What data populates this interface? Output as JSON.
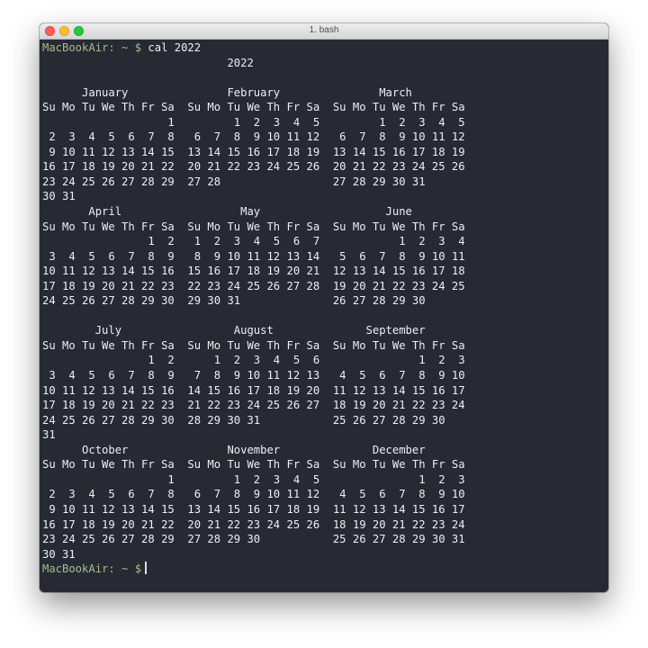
{
  "window": {
    "title": "1. bash",
    "traffic_light_colors": {
      "close": "#ff5f57",
      "minimize": "#ffbd2e",
      "zoom": "#28c940"
    }
  },
  "terminal": {
    "background": "#272a33",
    "prompt_color": "#a3be8c",
    "prompt": "MacBookAir: ~ $",
    "command": " cal 2022",
    "output_lines": [
      "                            2022",
      "",
      "      January               February               March",
      "Su Mo Tu We Th Fr Sa  Su Mo Tu We Th Fr Sa  Su Mo Tu We Th Fr Sa",
      "                   1         1  2  3  4  5         1  2  3  4  5",
      " 2  3  4  5  6  7  8   6  7  8  9 10 11 12   6  7  8  9 10 11 12",
      " 9 10 11 12 13 14 15  13 14 15 16 17 18 19  13 14 15 16 17 18 19",
      "16 17 18 19 20 21 22  20 21 22 23 24 25 26  20 21 22 23 24 25 26",
      "23 24 25 26 27 28 29  27 28                 27 28 29 30 31",
      "30 31",
      "       April                  May                   June",
      "Su Mo Tu We Th Fr Sa  Su Mo Tu We Th Fr Sa  Su Mo Tu We Th Fr Sa",
      "                1  2   1  2  3  4  5  6  7            1  2  3  4",
      " 3  4  5  6  7  8  9   8  9 10 11 12 13 14   5  6  7  8  9 10 11",
      "10 11 12 13 14 15 16  15 16 17 18 19 20 21  12 13 14 15 16 17 18",
      "17 18 19 20 21 22 23  22 23 24 25 26 27 28  19 20 21 22 23 24 25",
      "24 25 26 27 28 29 30  29 30 31              26 27 28 29 30",
      "",
      "        July                 August              September",
      "Su Mo Tu We Th Fr Sa  Su Mo Tu We Th Fr Sa  Su Mo Tu We Th Fr Sa",
      "                1  2      1  2  3  4  5  6               1  2  3",
      " 3  4  5  6  7  8  9   7  8  9 10 11 12 13   4  5  6  7  8  9 10",
      "10 11 12 13 14 15 16  14 15 16 17 18 19 20  11 12 13 14 15 16 17",
      "17 18 19 20 21 22 23  21 22 23 24 25 26 27  18 19 20 21 22 23 24",
      "24 25 26 27 28 29 30  28 29 30 31           25 26 27 28 29 30",
      "31",
      "      October               November              December",
      "Su Mo Tu We Th Fr Sa  Su Mo Tu We Th Fr Sa  Su Mo Tu We Th Fr Sa",
      "                   1         1  2  3  4  5               1  2  3",
      " 2  3  4  5  6  7  8   6  7  8  9 10 11 12   4  5  6  7  8  9 10",
      " 9 10 11 12 13 14 15  13 14 15 16 17 18 19  11 12 13 14 15 16 17",
      "16 17 18 19 20 21 22  20 21 22 23 24 25 26  18 19 20 21 22 23 24",
      "23 24 25 26 27 28 29  27 28 29 30           25 26 27 28 29 30 31",
      "30 31"
    ],
    "final_prompt": "MacBookAir: ~ $"
  }
}
